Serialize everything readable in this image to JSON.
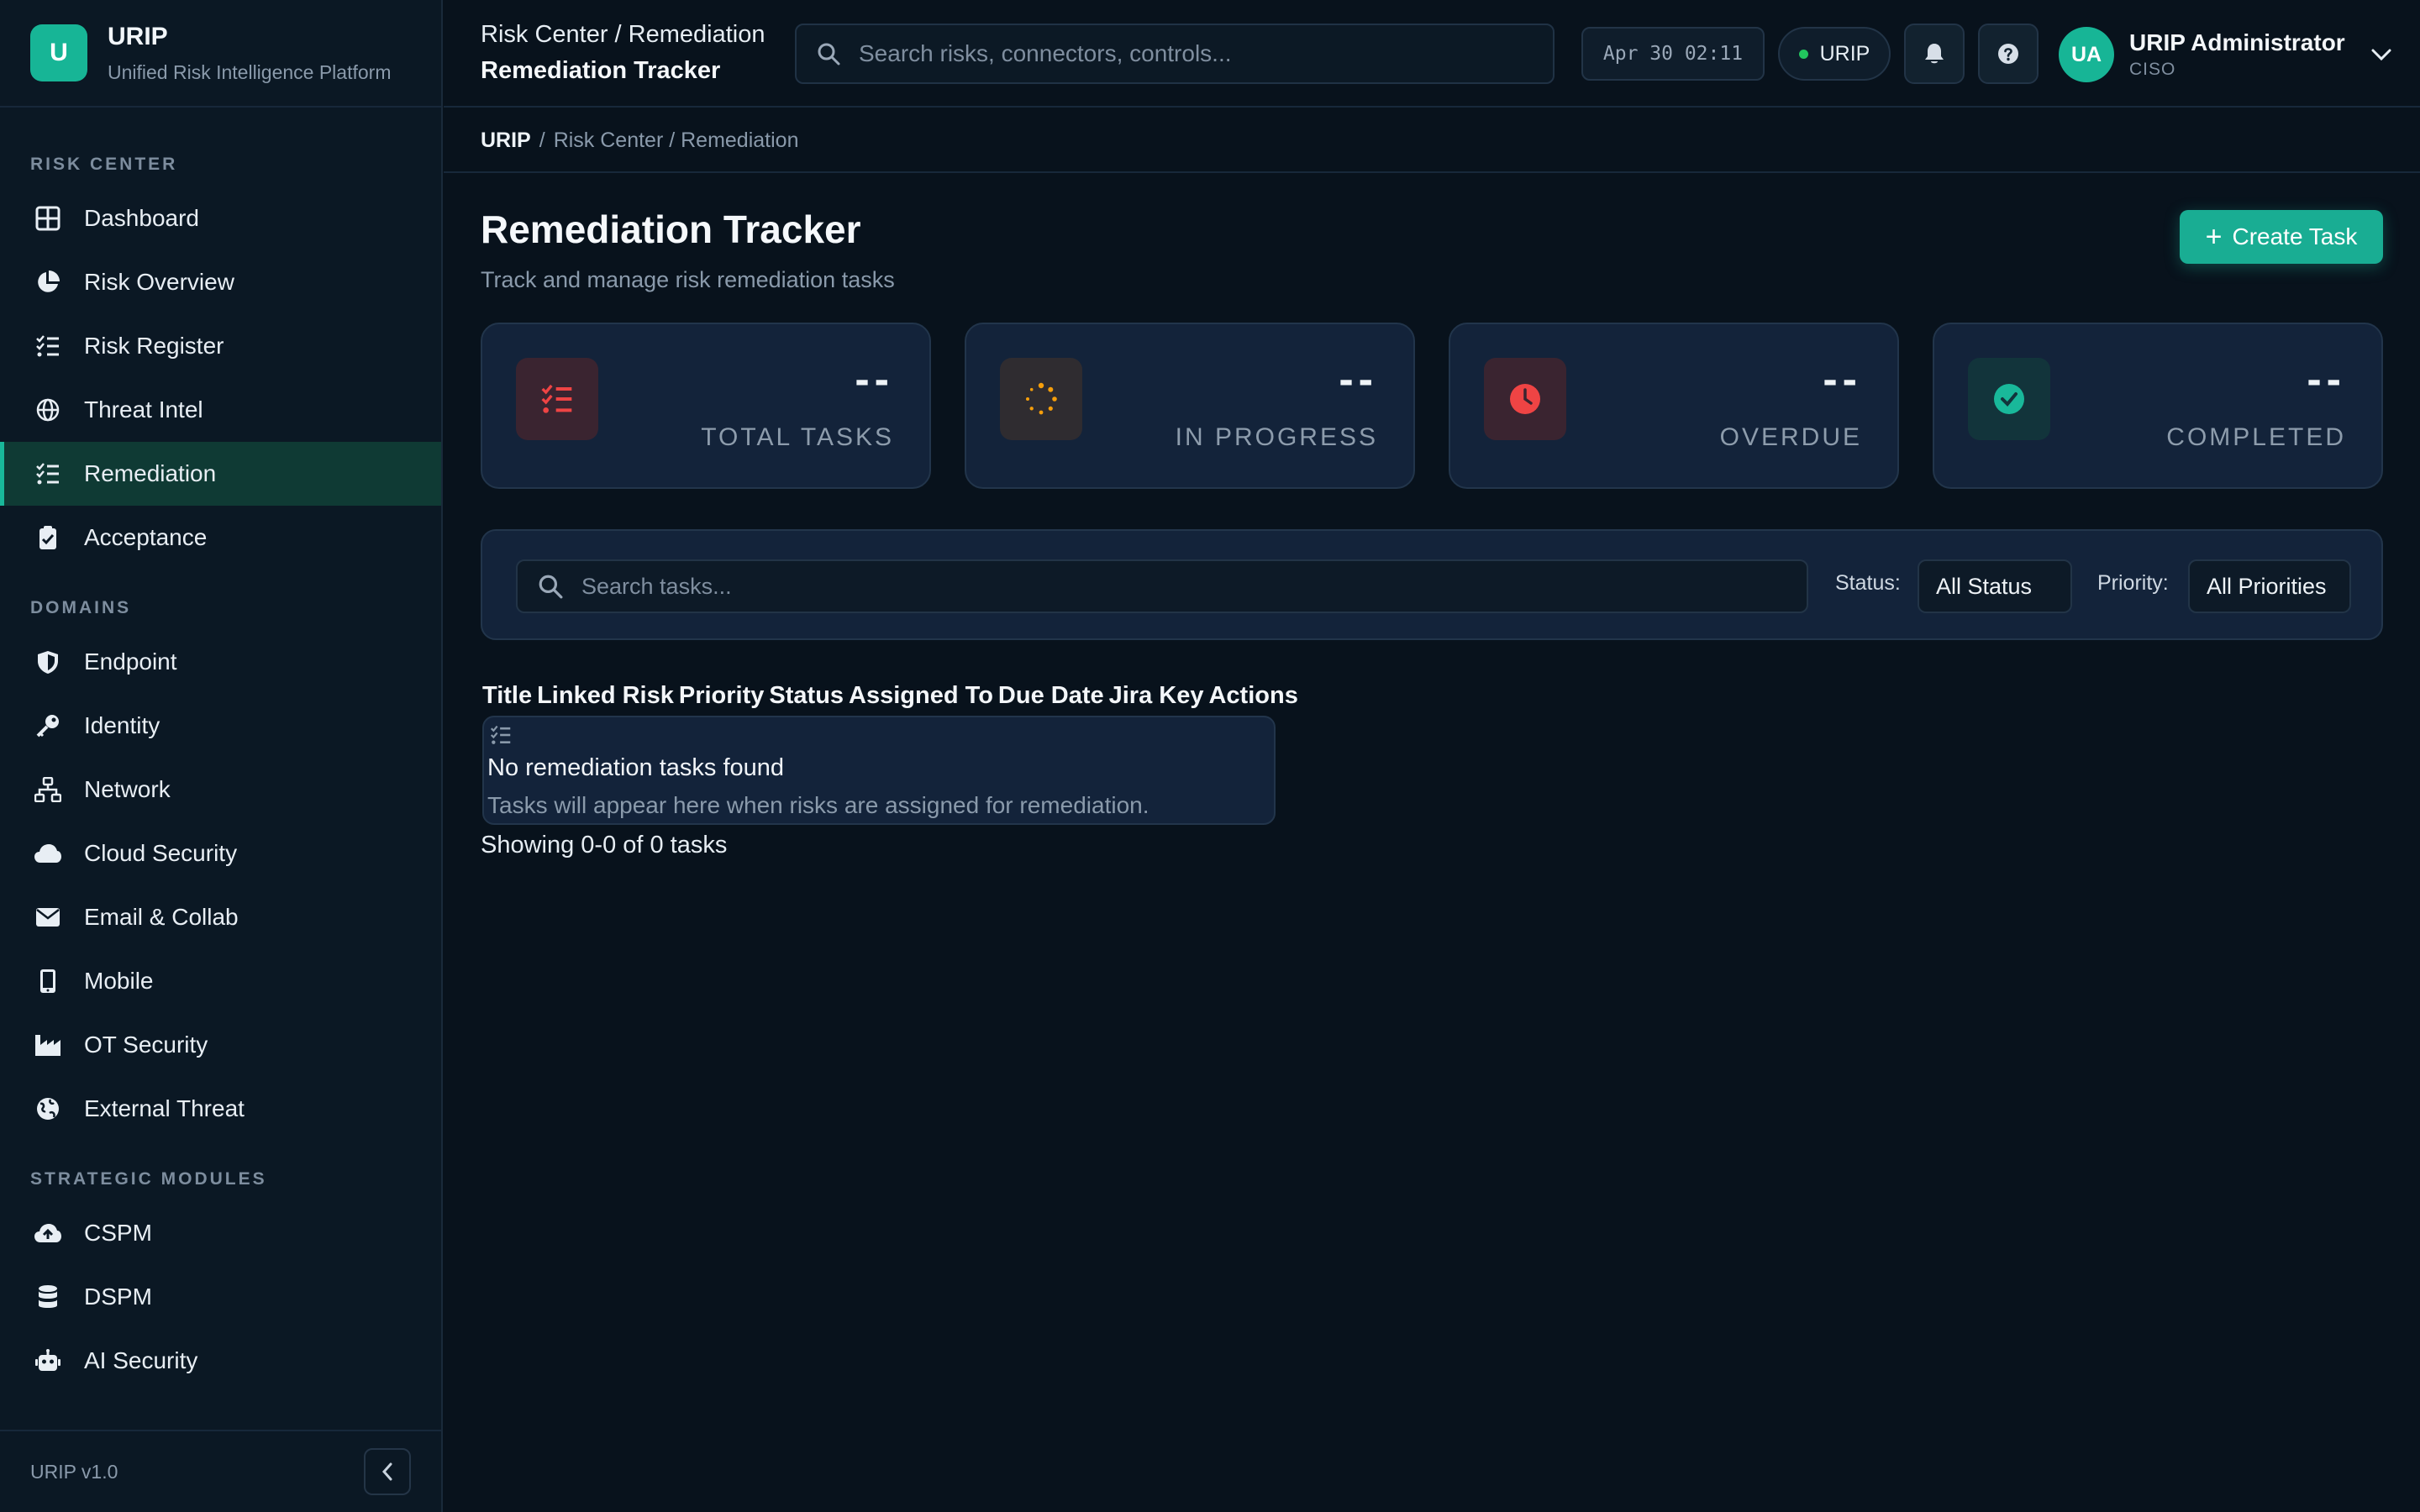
{
  "brand": {
    "logo_letter": "U",
    "name": "URIP",
    "subtitle": "Unified Risk Intelligence Platform"
  },
  "sidebar": {
    "sections": [
      {
        "label": "RISK CENTER",
        "items": [
          {
            "label": "Dashboard",
            "icon": "grid-icon"
          },
          {
            "label": "Risk Overview",
            "icon": "pie-chart-icon"
          },
          {
            "label": "Risk Register",
            "icon": "list-check-icon"
          },
          {
            "label": "Threat Intel",
            "icon": "globe-icon"
          },
          {
            "label": "Remediation",
            "icon": "list-check-icon",
            "active": true
          },
          {
            "label": "Acceptance",
            "icon": "clipboard-check-icon"
          }
        ]
      },
      {
        "label": "DOMAINS",
        "items": [
          {
            "label": "Endpoint",
            "icon": "shield-icon"
          },
          {
            "label": "Identity",
            "icon": "key-icon"
          },
          {
            "label": "Network",
            "icon": "network-icon"
          },
          {
            "label": "Cloud Security",
            "icon": "cloud-icon"
          },
          {
            "label": "Email & Collab",
            "icon": "envelope-icon"
          },
          {
            "label": "Mobile",
            "icon": "mobile-icon"
          },
          {
            "label": "OT Security",
            "icon": "industry-icon"
          },
          {
            "label": "External Threat",
            "icon": "globe-alt-icon"
          }
        ]
      },
      {
        "label": "STRATEGIC MODULES",
        "items": [
          {
            "label": "CSPM",
            "icon": "cloud-upload-icon"
          },
          {
            "label": "DSPM",
            "icon": "database-icon"
          },
          {
            "label": "AI Security",
            "icon": "robot-icon"
          }
        ]
      }
    ],
    "version": "URIP v1.0"
  },
  "topbar": {
    "path": "Risk Center / Remediation",
    "current": "Remediation Tracker",
    "search_placeholder": "Search risks, connectors, controls...",
    "clock": "Apr 30 02:11",
    "tenant": "URIP",
    "user": {
      "initials": "UA",
      "name": "URIP Administrator",
      "role": "CISO"
    }
  },
  "breadcrumb": {
    "root": "URIP",
    "rest": "Risk Center / Remediation"
  },
  "page": {
    "title": "Remediation Tracker",
    "subtitle": "Track and manage risk remediation tasks",
    "create_label": "Create Task"
  },
  "stats": [
    {
      "value": "--",
      "label": "TOTAL TASKS",
      "icon": "list-check-icon",
      "color": "#ef4444"
    },
    {
      "value": "--",
      "label": "IN PROGRESS",
      "icon": "spinner-icon",
      "color": "#f59e0b"
    },
    {
      "value": "--",
      "label": "OVERDUE",
      "icon": "clock-icon",
      "color": "#ef4444"
    },
    {
      "value": "--",
      "label": "COMPLETED",
      "icon": "check-circle-icon",
      "color": "#19b89a"
    }
  ],
  "filters": {
    "search_placeholder": "Search tasks...",
    "status_label": "Status:",
    "status_value": "All Status",
    "priority_label": "Priority:",
    "priority_value": "All Priorities"
  },
  "table": {
    "columns": [
      "Title",
      "Linked Risk",
      "Priority",
      "Status",
      "Assigned To",
      "Due Date",
      "Jira Key",
      "Actions"
    ],
    "empty_title": "No remediation tasks found",
    "empty_sub": "Tasks will appear here when risks are assigned for remediation.",
    "showing": "Showing 0-0 of 0 tasks"
  },
  "colors": {
    "accent": "#19b89a",
    "bg": "#08121c",
    "card": "#13233a"
  }
}
